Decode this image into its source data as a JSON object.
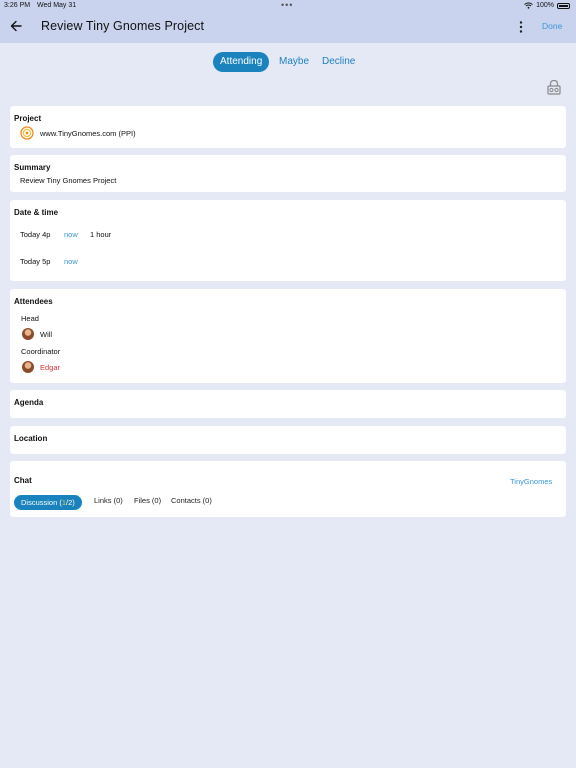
{
  "status_bar": {
    "time": "3:26 PM",
    "date": "Wed May 31",
    "battery": "100%"
  },
  "header": {
    "title": "Review Tiny Gnomes Project",
    "done_label": "Done"
  },
  "rsvp": {
    "attending": "Attending",
    "maybe": "Maybe",
    "decline": "Decline",
    "selected": "Attending"
  },
  "project": {
    "label": "Project",
    "value": "www.TinyGnomes.com (PPI)"
  },
  "summary": {
    "label": "Summary",
    "value": "Review Tiny Gnomes Project"
  },
  "datetime": {
    "label": "Date & time",
    "start_value": "Today 4p",
    "start_now": "now",
    "duration": "1 hour",
    "end_value": "Today 5p",
    "end_now": "now"
  },
  "attendees": {
    "label": "Attendees",
    "head_label": "Head",
    "head_name": "Will",
    "coordinator_label": "Coordinator",
    "coordinator_name": "Edgar"
  },
  "agenda": {
    "label": "Agenda"
  },
  "location": {
    "label": "Location"
  },
  "chat": {
    "label": "Chat",
    "channel": "TinyGnomes",
    "tabs": [
      {
        "label": "Discussion (",
        "highlight": "1",
        "suffix": "/2)"
      },
      {
        "label": "Links (0)"
      },
      {
        "label": "Files (0)"
      },
      {
        "label": "Contacts (0)"
      }
    ]
  },
  "colors": {
    "accent": "#1a83bd",
    "link": "#3a97d6",
    "header_bg": "#c9d3ee",
    "page_bg": "#e5e9f6",
    "alert": "#d8333a",
    "highlight": "#f3c53b"
  }
}
